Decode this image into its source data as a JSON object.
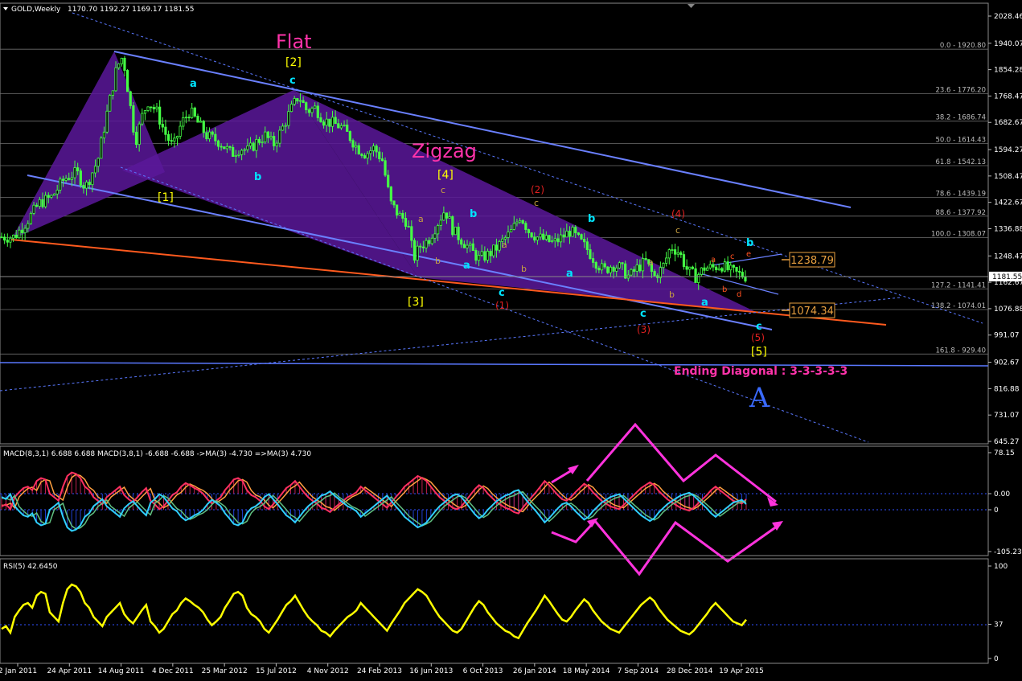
{
  "header": {
    "symbol": "GOLD,Weekly",
    "ohlc": "1170.70 1192.27 1169.17 1181.55"
  },
  "colors": {
    "background": "#000000",
    "grid": "#6e6e6e",
    "candle": "#44ff44",
    "channel": "#5a78ff",
    "triangle_fill": "#5a189a",
    "orange_line": "#ff5a1e",
    "magenta": "#ff33dd",
    "rsi": "#ffff00",
    "macd_red": "#ff3060",
    "macd_cyan": "#30d0ff",
    "macd_orange": "#ffa040"
  },
  "chart_data": [
    {
      "type": "candlestick",
      "title": "GOLD,Weekly",
      "ylim": [
        645.27,
        2028.46
      ],
      "y_ticks": [
        "2028.46",
        "1940.07",
        "1854.28",
        "1768.47",
        "1682.67",
        "1594.27",
        "1508.47",
        "1422.67",
        "1336.88",
        "1248.47",
        "1162.67",
        "1076.88",
        "991.07",
        "902.67",
        "816.88",
        "731.07",
        "645.27"
      ],
      "price_marker": "1181.55",
      "x_ticks": [
        "2 Jan 2011",
        "24 Apr 2011",
        "14 Aug 2011",
        "4 Dec 2011",
        "25 Mar 2012",
        "15 Jul 2012",
        "4 Nov 2012",
        "24 Feb 2013",
        "16 Jun 2013",
        "6 Oct 2013",
        "26 Jan 2014",
        "18 May 2014",
        "7 Sep 2014",
        "28 Dec 2014",
        "19 Apr 2015"
      ],
      "fib_levels": [
        {
          "label": "0.0 - 1920.80",
          "value": 1920.8
        },
        {
          "label": "23.6 - 1776.20",
          "value": 1776.2
        },
        {
          "label": "38.2 - 1686.74",
          "value": 1686.74
        },
        {
          "label": "50.0 - 1614.43",
          "value": 1614.43
        },
        {
          "label": "61.8 - 1542.13",
          "value": 1542.13
        },
        {
          "label": "78.6 - 1439.19",
          "value": 1439.19
        },
        {
          "label": "88.6 - 1377.92",
          "value": 1377.92
        },
        {
          "label": "100.0 - 1308.07",
          "value": 1308.07
        },
        {
          "label": "127.2 - 1141.41",
          "value": 1141.41
        },
        {
          "label": "138.2 - 1074.01",
          "value": 1074.01
        },
        {
          "label": "161.8 - 929.40",
          "value": 929.4
        }
      ],
      "price_boxes": [
        "1238.79",
        "1074.34"
      ],
      "path": [
        [
          0,
          1310
        ],
        [
          6,
          1310
        ],
        [
          12,
          1360
        ],
        [
          18,
          1420
        ],
        [
          24,
          1440
        ],
        [
          30,
          1500
        ],
        [
          36,
          1520
        ],
        [
          40,
          1470
        ],
        [
          46,
          1560
        ],
        [
          50,
          1700
        ],
        [
          55,
          1860
        ],
        [
          58,
          1900
        ],
        [
          61,
          1760
        ],
        [
          64,
          1620
        ],
        [
          67,
          1700
        ],
        [
          70,
          1750
        ],
        [
          74,
          1720
        ],
        [
          78,
          1650
        ],
        [
          82,
          1600
        ],
        [
          86,
          1680
        ],
        [
          90,
          1720
        ],
        [
          94,
          1680
        ],
        [
          98,
          1640
        ],
        [
          104,
          1620
        ],
        [
          110,
          1580
        ],
        [
          114,
          1600
        ],
        [
          118,
          1590
        ],
        [
          122,
          1620
        ],
        [
          126,
          1640
        ],
        [
          130,
          1610
        ],
        [
          134,
          1660
        ],
        [
          138,
          1720
        ],
        [
          142,
          1770
        ],
        [
          146,
          1720
        ],
        [
          150,
          1730
        ],
        [
          154,
          1690
        ],
        [
          158,
          1680
        ],
        [
          162,
          1670
        ],
        [
          166,
          1640
        ],
        [
          170,
          1600
        ],
        [
          174,
          1580
        ],
        [
          178,
          1600
        ],
        [
          182,
          1560
        ],
        [
          186,
          1420
        ],
        [
          190,
          1380
        ],
        [
          194,
          1360
        ],
        [
          197,
          1240
        ],
        [
          200,
          1280
        ],
        [
          204,
          1300
        ],
        [
          208,
          1350
        ],
        [
          212,
          1400
        ],
        [
          216,
          1330
        ],
        [
          220,
          1300
        ],
        [
          224,
          1270
        ],
        [
          228,
          1240
        ],
        [
          232,
          1250
        ],
        [
          236,
          1270
        ],
        [
          240,
          1300
        ],
        [
          244,
          1330
        ],
        [
          248,
          1380
        ],
        [
          252,
          1330
        ],
        [
          256,
          1310
        ],
        [
          260,
          1300
        ],
        [
          264,
          1290
        ],
        [
          268,
          1310
        ],
        [
          272,
          1330
        ],
        [
          276,
          1300
        ],
        [
          280,
          1270
        ],
        [
          284,
          1230
        ],
        [
          288,
          1200
        ],
        [
          292,
          1220
        ],
        [
          296,
          1210
        ],
        [
          300,
          1180
        ],
        [
          304,
          1210
        ],
        [
          308,
          1230
        ],
        [
          312,
          1180
        ],
        [
          316,
          1210
        ],
        [
          320,
          1280
        ],
        [
          324,
          1260
        ],
        [
          328,
          1200
        ],
        [
          332,
          1180
        ],
        [
          336,
          1210
        ],
        [
          340,
          1210
        ],
        [
          344,
          1220
        ],
        [
          348,
          1200
        ],
        [
          352,
          1190
        ],
        [
          356,
          1182
        ]
      ],
      "annotations": {
        "flat": "Flat",
        "zigzag": "Zigzag",
        "ending": "Ending Diagonal : 3-3-3-3-3",
        "big_A": "A",
        "w2": "[2]",
        "w1": "[1]",
        "w3": "[3]",
        "w4": "[4]",
        "w5": "[5]",
        "c": "c",
        "a": "a",
        "b": "b",
        "r1": "(1)",
        "r2": "(2)",
        "r3": "(3)",
        "r4": "(4)",
        "r5": "(5)",
        "d": "d",
        "e": "e"
      }
    },
    {
      "type": "line",
      "title": "MACD(8,3,1) 6.688 6.688  MACD(3,8,1) -6.688 -6.688  ->MA(3) -4.730  =>MA(3) 4.730",
      "ylim": [
        -105.234,
        78.15
      ],
      "y_ticks": [
        "78.15",
        "0.00",
        "0",
        "-105.234"
      ]
    },
    {
      "type": "line",
      "title": "RSI(5) 42.6450",
      "ylim": [
        0,
        100
      ],
      "y_ticks": [
        "100",
        "37",
        "0"
      ],
      "values": [
        32,
        35,
        28,
        45,
        52,
        58,
        60,
        55,
        68,
        72,
        70,
        50,
        45,
        40,
        60,
        75,
        80,
        78,
        72,
        60,
        55,
        45,
        40,
        35,
        45,
        50,
        55,
        60,
        48,
        42,
        38,
        45,
        52,
        58,
        40,
        35,
        28,
        32,
        40,
        48,
        52,
        60,
        65,
        62,
        58,
        55,
        50,
        42,
        36,
        40,
        45,
        55,
        62,
        70,
        72,
        68,
        55,
        48,
        45,
        40,
        32,
        28,
        35,
        42,
        50,
        58,
        62,
        68,
        60,
        52,
        45,
        40,
        36,
        30,
        28,
        24,
        30,
        35,
        40,
        45,
        48,
        52,
        60,
        55,
        50,
        45,
        40,
        35,
        30,
        38,
        45,
        52,
        60,
        65,
        70,
        75,
        72,
        68,
        60,
        52,
        45,
        40,
        35,
        30,
        28,
        32,
        40,
        48,
        56,
        62,
        58,
        50,
        44,
        38,
        34,
        30,
        28,
        24,
        22,
        30,
        38,
        45,
        52,
        60,
        68,
        62,
        55,
        48,
        42,
        40,
        45,
        52,
        58,
        64,
        60,
        52,
        46,
        40,
        36,
        32,
        30,
        28,
        34,
        40,
        46,
        52,
        58,
        62,
        66,
        62,
        54,
        48,
        42,
        38,
        34,
        30,
        28,
        26,
        30,
        36,
        42,
        48,
        55,
        60,
        55,
        50,
        45,
        40,
        38,
        36,
        42
      ]
    }
  ]
}
